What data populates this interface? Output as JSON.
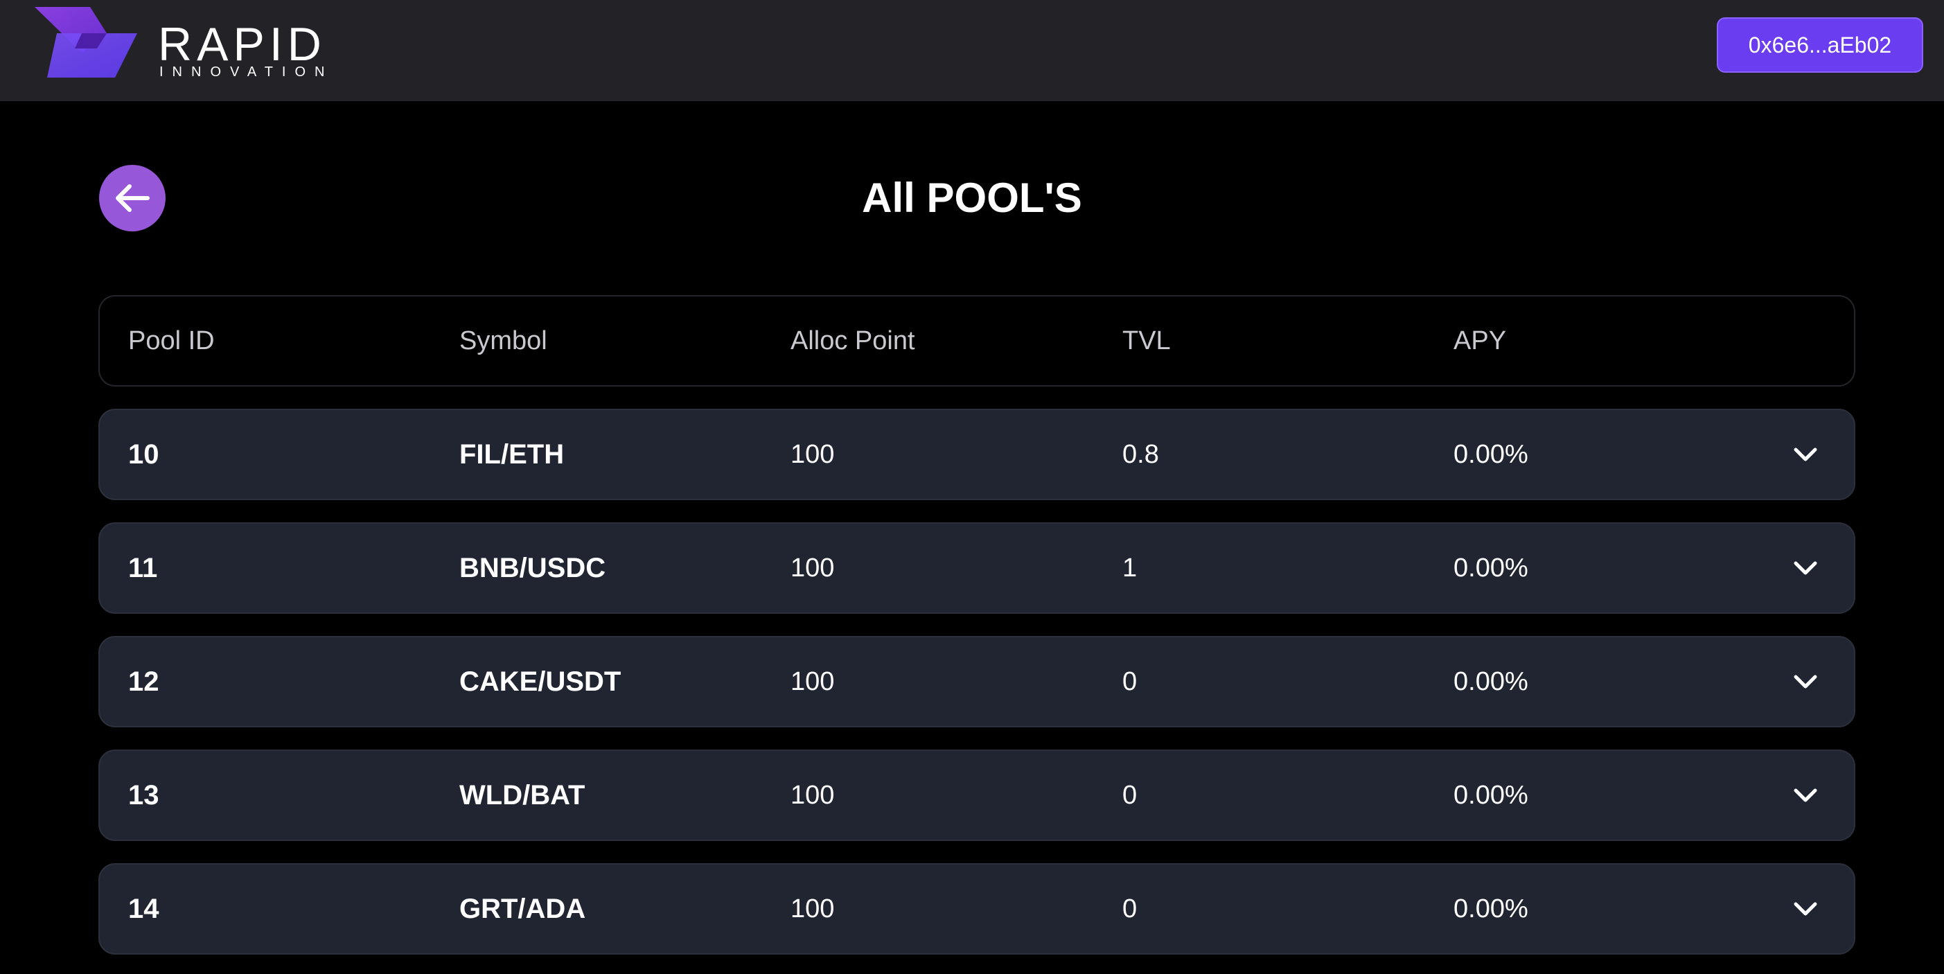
{
  "header": {
    "brand_word": "RAPID",
    "brand_sub": "INNOVATION",
    "wallet_address": "0x6e6...aEb02"
  },
  "page": {
    "title": "All POOL'S",
    "back_icon": "arrow-left-icon"
  },
  "table": {
    "columns": [
      "Pool ID",
      "Symbol",
      "Alloc Point",
      "TVL",
      "APY"
    ],
    "rows": [
      {
        "pool_id": "10",
        "symbol": "FIL/ETH",
        "alloc_point": "100",
        "tvl": "0.8",
        "apy": "0.00%"
      },
      {
        "pool_id": "11",
        "symbol": "BNB/USDC",
        "alloc_point": "100",
        "tvl": "1",
        "apy": "0.00%"
      },
      {
        "pool_id": "12",
        "symbol": "CAKE/USDT",
        "alloc_point": "100",
        "tvl": "0",
        "apy": "0.00%"
      },
      {
        "pool_id": "13",
        "symbol": "WLD/BAT",
        "alloc_point": "100",
        "tvl": "0",
        "apy": "0.00%"
      },
      {
        "pool_id": "14",
        "symbol": "GRT/ADA",
        "alloc_point": "100",
        "tvl": "0",
        "apy": "0.00%"
      }
    ],
    "row_expand_icon": "chevron-down-icon"
  },
  "colors": {
    "topbar_bg": "#232227",
    "page_bg": "#000000",
    "accent_purple": "#6a3df0",
    "back_button": "#9657d8",
    "row_bg": "#212531"
  }
}
